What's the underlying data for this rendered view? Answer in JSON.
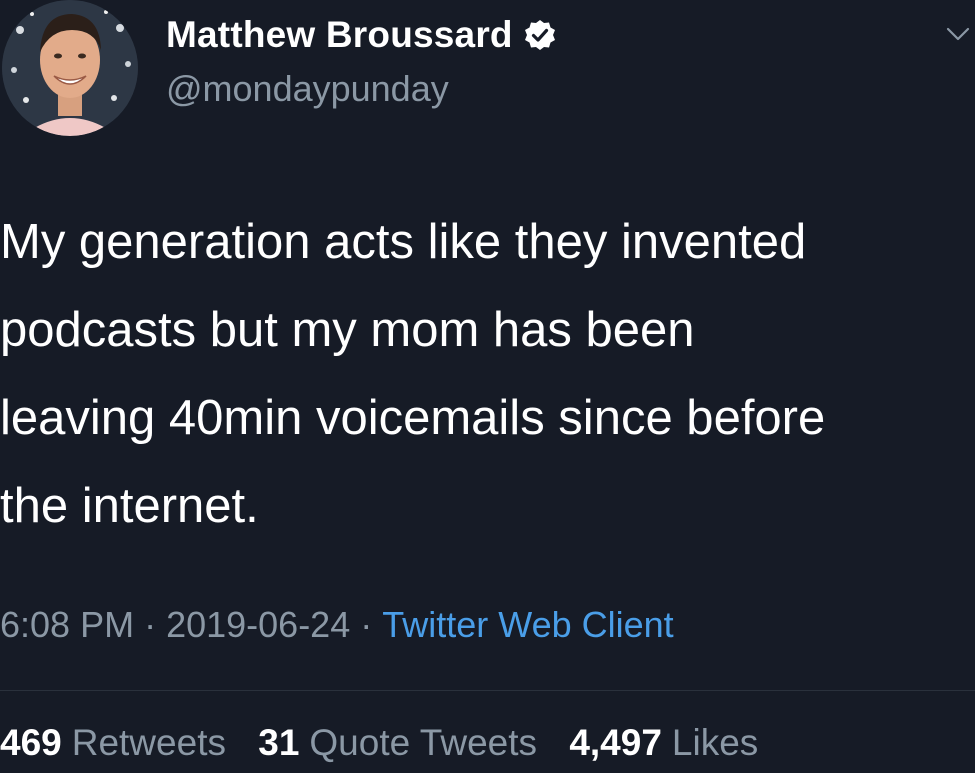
{
  "author": {
    "display_name": "Matthew Broussard",
    "handle": "@mondaypunday",
    "verified": true
  },
  "tweet": {
    "text": "My generation acts like they invented\npodcasts but my mom has been\nleaving 40min voicemails since before\nthe internet."
  },
  "meta": {
    "time": "6:08 PM",
    "separator": "·",
    "date": "2019-06-24",
    "client": "Twitter Web Client"
  },
  "stats": {
    "retweets_count": "469",
    "retweets_label": "Retweets",
    "quote_count": "31",
    "quote_label": "Quote Tweets",
    "likes_count": "4,497",
    "likes_label": "Likes"
  },
  "colors": {
    "background": "#161b26",
    "text_primary": "#ffffff",
    "text_secondary": "#8b98a5",
    "link": "#4a9ee8",
    "divider": "#2a313c"
  },
  "icons": {
    "verified": "verified-badge-icon",
    "menu": "chevron-down-icon"
  }
}
